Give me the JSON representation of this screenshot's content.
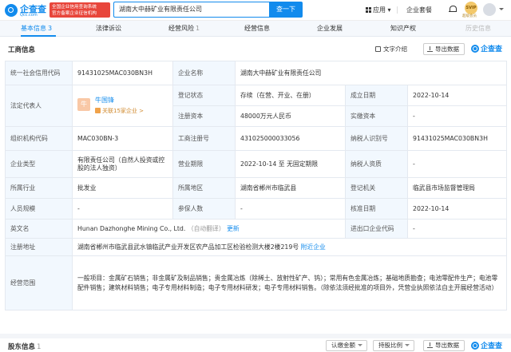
{
  "header": {
    "logo_text": "企查查",
    "logo_sub": "Qcc.com",
    "official_line1": "全国企业信用查询系统",
    "official_line2": "官方备案企业征信机构",
    "search_value": "湖南大中赫矿业有限责任公司",
    "search_button": "查一下",
    "apps_label": "应用",
    "package_label": "企业套餐",
    "vip_badge": "SVIP",
    "vip_text": "超级会员"
  },
  "tabs": [
    {
      "label": "基本信息",
      "count": "3"
    },
    {
      "label": "法律诉讼",
      "count": ""
    },
    {
      "label": "经营风险",
      "count": "1"
    },
    {
      "label": "经营信息",
      "count": ""
    },
    {
      "label": "企业发展",
      "count": ""
    },
    {
      "label": "知识产权",
      "count": ""
    },
    {
      "label": "历史信息",
      "count": ""
    }
  ],
  "section": {
    "title": "工商信息",
    "text_intro": "文字介绍",
    "export": "导出数据",
    "watermark": "企查查"
  },
  "info": {
    "credit_code_label": "统一社会信用代码",
    "credit_code": "91431025MAC030BN3H",
    "company_name_label": "企业名称",
    "company_name": "湖南大中赫矿业有限责任公司",
    "legal_rep_label": "法定代表人",
    "legal_rep_avatar": "牛",
    "legal_rep_name": "牛国锋",
    "legal_rep_related": "关联15家企业 >",
    "reg_status_label": "登记状态",
    "reg_status": "存续（在营、开业、在册）",
    "est_date_label": "成立日期",
    "est_date": "2022-10-14",
    "reg_capital_label": "注册资本",
    "reg_capital": "48000万元人民币",
    "paid_capital_label": "实缴资本",
    "paid_capital": "-",
    "org_code_label": "组织机构代码",
    "org_code": "MAC030BN-3",
    "biz_reg_no_label": "工商注册号",
    "biz_reg_no": "431025000033056",
    "taxpayer_id_label": "纳税人识别号",
    "taxpayer_id": "91431025MAC030BN3H",
    "ent_type_label": "企业类型",
    "ent_type": "有限责任公司（自然人投资或控股的法人独资）",
    "biz_term_label": "营业期限",
    "biz_term": "2022-10-14 至 无固定期限",
    "taxpayer_qual_label": "纳税人资质",
    "taxpayer_qual": "-",
    "industry_label": "所属行业",
    "industry": "批发业",
    "region_label": "所属地区",
    "region": "湖南省郴州市临武县",
    "reg_authority_label": "登记机关",
    "reg_authority": "临武县市场监督管理局",
    "staff_size_label": "人员规模",
    "staff_size": "-",
    "insured_label": "参保人数",
    "insured": "-",
    "approval_date_label": "核准日期",
    "approval_date": "2022-10-14",
    "en_name_label": "英文名",
    "en_name": "Hunan Dazhonghe Mining Co., Ltd.",
    "en_name_note": "（自动翻译）",
    "en_name_update": "更新",
    "ie_code_label": "进出口企业代码",
    "ie_code": "-",
    "address_label": "注册地址",
    "address": "湖南省郴州市临武县武水镇临武产业开发区农产品加工区检验检测大楼2楼219号",
    "address_nearby": "附近企业",
    "scope_label": "经营范围",
    "scope": "一般项目：金属矿石销售；非金属矿及制品销售；贵金属冶炼（除稀土、放射性矿产、钨）；常用有色金属冶炼；基础地质勘查；电池零配件生产；电池零配件销售；建筑材料销售；电子专用材料制造；电子专用材料研发；电子专用材料销售。（除依法须经批准的项目外，凭营业执照依法自主开展经营活动）"
  },
  "bottom": {
    "title": "股东信息",
    "count": "1",
    "btn_paid": "认缴金额",
    "btn_ratio": "持股比例",
    "btn_export": "导出数据",
    "watermark": "企查查"
  }
}
